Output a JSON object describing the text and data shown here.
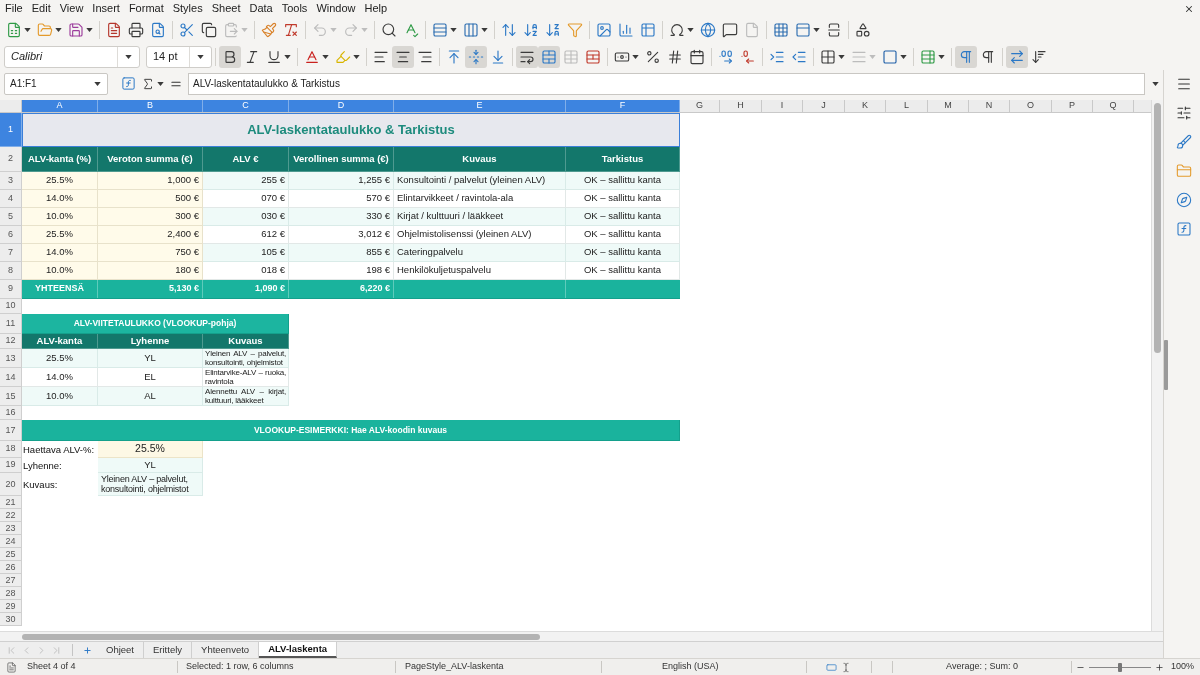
{
  "menu_bar": [
    "File",
    "Edit",
    "View",
    "Insert",
    "Format",
    "Styles",
    "Sheet",
    "Data",
    "Tools",
    "Window",
    "Help"
  ],
  "standard_toolbar": [
    {
      "disabled": false
    },
    {
      "disabled": false
    },
    {
      "disabled": false
    },
    {
      "disabled": false
    },
    {
      "disabled": false
    },
    {
      "disabled": false
    },
    {
      "disabled": false
    },
    {
      "disabled": false
    },
    {
      "disabled": true
    },
    {
      "disabled": false
    },
    {
      "disabled": false
    },
    {
      "disabled": true
    },
    {
      "disabled": true
    },
    {
      "disabled": false
    },
    {
      "disabled": false
    },
    {
      "disabled": false
    },
    {
      "disabled": false
    },
    {
      "disabled": false
    },
    {
      "disabled": false
    },
    {
      "disabled": false
    },
    {
      "disabled": false
    },
    {
      "disabled": false
    },
    {
      "disabled": false
    },
    {
      "disabled": false
    },
    {
      "disabled": false
    },
    {
      "disabled": false
    },
    {
      "disabled": false
    },
    {
      "disabled": true
    },
    {
      "disabled": false
    },
    {
      "disabled": false
    },
    {
      "disabled": false
    },
    {
      "disabled": false
    }
  ],
  "formatting_toolbar": {
    "font_name": "Calibri",
    "font_size": "14 pt",
    "buttons": [
      {
        "pressed": true,
        "disabled": false
      },
      {
        "pressed": false,
        "disabled": false
      },
      {
        "pressed": false,
        "disabled": false
      },
      {
        "pressed": false,
        "disabled": false
      },
      {
        "pressed": false,
        "disabled": false
      },
      {
        "pressed": false,
        "disabled": false
      },
      {
        "pressed": true,
        "disabled": false
      },
      {
        "pressed": false,
        "disabled": false
      },
      {
        "pressed": false,
        "disabled": false
      },
      {
        "pressed": true,
        "disabled": false
      },
      {
        "pressed": false,
        "disabled": false
      },
      {
        "pressed": true,
        "disabled": false
      },
      {
        "pressed": true,
        "disabled": false
      },
      {
        "pressed": false,
        "disabled": true
      },
      {
        "pressed": false,
        "disabled": false
      },
      {
        "pressed": false,
        "disabled": false
      },
      {
        "pressed": false,
        "disabled": false
      },
      {
        "pressed": false,
        "disabled": false
      },
      {
        "pressed": false,
        "disabled": false
      },
      {
        "pressed": false,
        "disabled": false
      },
      {
        "pressed": false,
        "disabled": false
      },
      {
        "pressed": false,
        "disabled": false
      },
      {
        "pressed": false,
        "disabled": false
      },
      {
        "pressed": false,
        "disabled": false
      },
      {
        "pressed": false,
        "disabled": true
      },
      {
        "pressed": false,
        "disabled": false
      },
      {
        "pressed": false,
        "disabled": false
      },
      {
        "pressed": true,
        "disabled": false
      },
      {
        "pressed": false,
        "disabled": false
      },
      {
        "pressed": true,
        "disabled": false
      },
      {
        "pressed": false,
        "disabled": false
      }
    ]
  },
  "formula_bar": {
    "name_box": "A1:F1",
    "content": "ALV-laskentataulukko & Tarkistus"
  },
  "sheet": {
    "columns": [
      {
        "label": "A",
        "selected": true
      },
      {
        "label": "B",
        "selected": true
      },
      {
        "label": "C",
        "selected": true
      },
      {
        "label": "D",
        "selected": true
      },
      {
        "label": "E",
        "selected": true
      },
      {
        "label": "F",
        "selected": true
      },
      {
        "label": "G",
        "selected": false
      },
      {
        "label": "H",
        "selected": false
      },
      {
        "label": "I",
        "selected": false
      },
      {
        "label": "J",
        "selected": false
      },
      {
        "label": "K",
        "selected": false
      },
      {
        "label": "L",
        "selected": false
      },
      {
        "label": "M",
        "selected": false
      },
      {
        "label": "N",
        "selected": false
      },
      {
        "label": "O",
        "selected": false
      },
      {
        "label": "P",
        "selected": false
      },
      {
        "label": "Q",
        "selected": false
      }
    ],
    "row_numbers": [
      {
        "label": "1",
        "selected": true
      },
      {
        "label": "2",
        "selected": false
      },
      {
        "label": "3",
        "selected": false
      },
      {
        "label": "4",
        "selected": false
      },
      {
        "label": "5",
        "selected": false
      },
      {
        "label": "6",
        "selected": false
      },
      {
        "label": "7",
        "selected": false
      },
      {
        "label": "8",
        "selected": false
      },
      {
        "label": "9",
        "selected": false
      },
      {
        "label": "10",
        "selected": false
      },
      {
        "label": "11",
        "selected": false
      },
      {
        "label": "12",
        "selected": false
      },
      {
        "label": "13",
        "selected": false
      },
      {
        "label": "14",
        "selected": false
      },
      {
        "label": "15",
        "selected": false
      },
      {
        "label": "16",
        "selected": false
      },
      {
        "label": "17",
        "selected": false
      },
      {
        "label": "18",
        "selected": false
      },
      {
        "label": "19",
        "selected": false
      },
      {
        "label": "20",
        "selected": false
      },
      {
        "label": "21",
        "selected": false
      },
      {
        "label": "22",
        "selected": false
      },
      {
        "label": "23",
        "selected": false
      },
      {
        "label": "24",
        "selected": false
      },
      {
        "label": "25",
        "selected": false
      },
      {
        "label": "26",
        "selected": false
      },
      {
        "label": "27",
        "selected": false
      },
      {
        "label": "28",
        "selected": false
      },
      {
        "label": "29",
        "selected": false
      },
      {
        "label": "30",
        "selected": false
      }
    ],
    "title": {
      "text": "ALV-laskentataulukko & Tarkistus",
      "selected": true
    },
    "vat_table": {
      "headers": [
        "ALV-kanta (%)",
        "Veroton summa (€)",
        "ALV €",
        "Verollinen summa (€)",
        "Kuvaus",
        "Tarkistus"
      ],
      "rows": [
        {
          "rate": "25.5%",
          "net": "1,000 €",
          "vat": "255 €",
          "gross": "1,255 €",
          "description": "Konsultointi / palvelut (yleinen ALV)",
          "check": "OK – sallittu kanta"
        },
        {
          "rate": "14.0%",
          "net": "500 €",
          "vat": "070 €",
          "gross": "570 €",
          "description": "Elintarvikkeet / ravintola-ala",
          "check": "OK – sallittu kanta"
        },
        {
          "rate": "10.0%",
          "net": "300 €",
          "vat": "030 €",
          "gross": "330 €",
          "description": "Kirjat / kulttuuri / lääkkeet",
          "check": "OK – sallittu kanta"
        },
        {
          "rate": "25.5%",
          "net": "2,400 €",
          "vat": "612 €",
          "gross": "3,012 €",
          "description": "Ohjelmistolisenssi (yleinen ALV)",
          "check": "OK – sallittu kanta"
        },
        {
          "rate": "14.0%",
          "net": "750 €",
          "vat": "105 €",
          "gross": "855 €",
          "description": "Cateringpalvelu",
          "check": "OK – sallittu kanta"
        },
        {
          "rate": "10.0%",
          "net": "180 €",
          "vat": "018 €",
          "gross": "198 €",
          "description": "Henkilökuljetuspalvelu",
          "check": "OK – sallittu kanta"
        }
      ],
      "total": {
        "label": "YHTEENSÄ",
        "net": "5,130 €",
        "vat": "1,090 €",
        "gross": "6,220 €"
      }
    },
    "reference_table": {
      "title": "ALV-VIITETAULUKKO (VLOOKUP-pohja)",
      "headers": [
        "ALV-kanta",
        "Lyhenne",
        "Kuvaus"
      ],
      "rows": [
        {
          "rate": "25.5%",
          "code": "YL",
          "description": "Yleinen ALV – palvelut, konsultointi, ohjelmistot"
        },
        {
          "rate": "14.0%",
          "code": "EL",
          "description": "Elintarvike-ALV – ruoka, ravintola"
        },
        {
          "rate": "10.0%",
          "code": "AL",
          "description": "Alennettu ALV – kirjat, kulttuuri, lääkkeet"
        }
      ]
    },
    "lookup_example": {
      "title": "VLOOKUP-ESIMERKKI: Hae ALV-koodin kuvaus",
      "fields": [
        {
          "label": "Haettava ALV-%:",
          "value": "25.5%",
          "kind": "input"
        },
        {
          "label": "Lyhenne:",
          "value": "YL",
          "kind": "result"
        },
        {
          "label": "Kuvaus:",
          "value": "Yleinen ALV – palvelut, konsultointi, ohjelmistot",
          "kind": "result_text"
        }
      ]
    }
  },
  "sheet_tabs": {
    "navigation": [
      {
        "disabled": true
      },
      {
        "disabled": true
      },
      {
        "disabled": true
      },
      {
        "disabled": true
      }
    ],
    "tabs": [
      {
        "label": "Ohjeet",
        "selected": false
      },
      {
        "label": "Erittely",
        "selected": false
      },
      {
        "label": "Yhteenveto",
        "selected": false
      },
      {
        "label": "ALV-laskenta",
        "selected": true
      }
    ]
  },
  "status_bar": {
    "sheet_position": "Sheet 4 of 4",
    "selection": "Selected: 1 row, 6 columns",
    "page_style": "PageStyle_ALV-laskenta",
    "language": "English (USA)",
    "summary": "Average: ; Sum: 0",
    "zoom": "100%",
    "zoom_slider": {
      "level": 0.5
    }
  }
}
